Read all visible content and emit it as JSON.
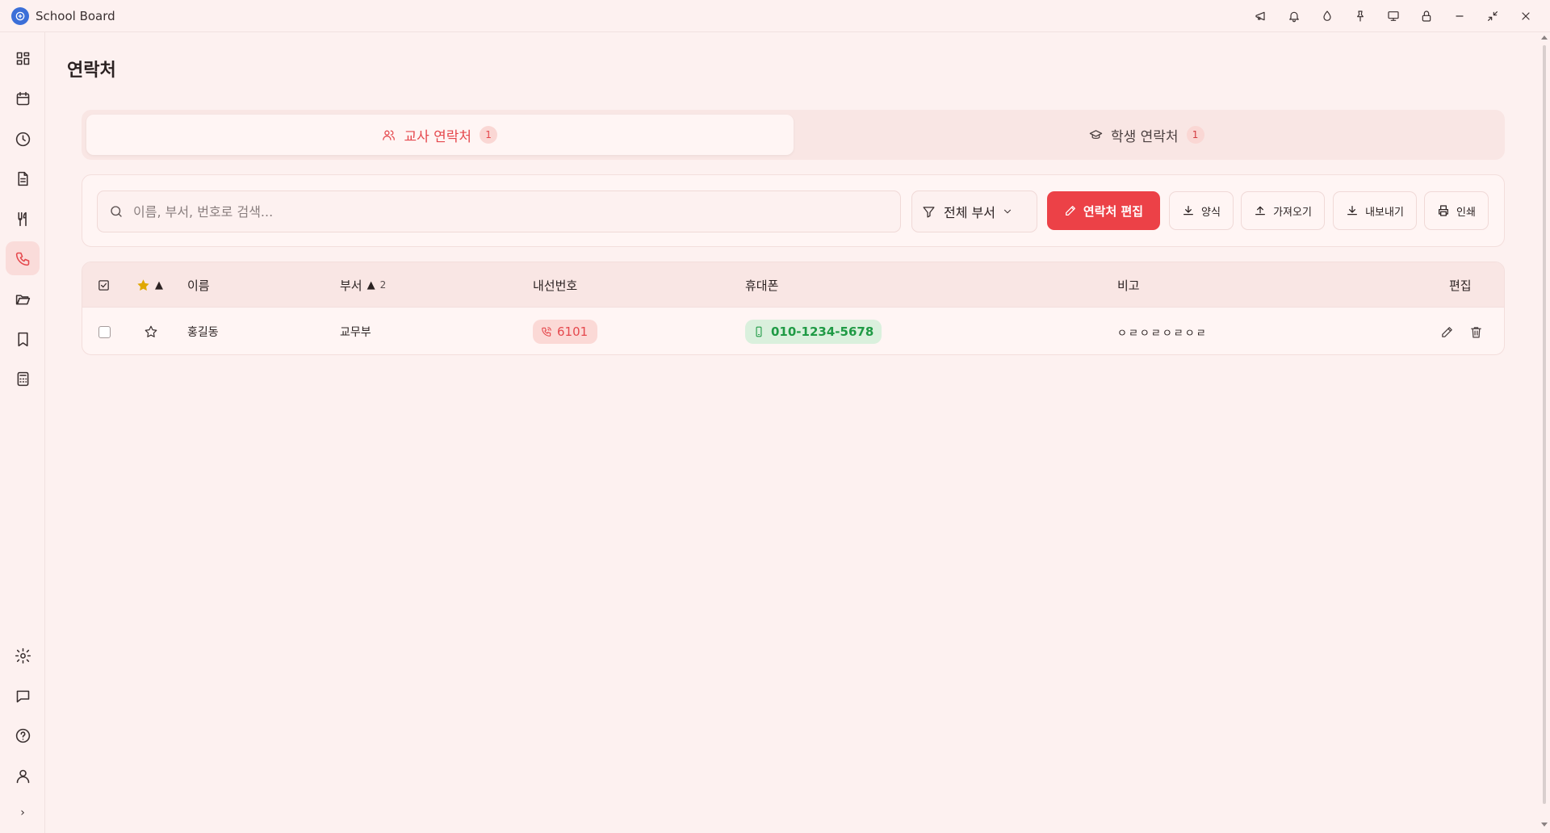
{
  "app": {
    "title": "School Board"
  },
  "page": {
    "title": "연락처"
  },
  "tabs": [
    {
      "label": "교사 연락처",
      "count": "1",
      "icon": "users-icon",
      "active": true
    },
    {
      "label": "학생 연락처",
      "count": "1",
      "icon": "graduation-cap-icon",
      "active": false
    }
  ],
  "toolbar": {
    "search_placeholder": "이름, 부서, 번호로 검색...",
    "search_value": "",
    "department_filter": "전체 부서",
    "edit_label": "연락처 편집",
    "template_label": "양식",
    "import_label": "가져오기",
    "export_label": "내보내기",
    "print_label": "인쇄"
  },
  "table": {
    "headers": {
      "favorite_sort": "▲",
      "name": "이름",
      "department": "부서",
      "department_sort": "▲",
      "department_sort_count": "2",
      "extension": "내선번호",
      "mobile": "휴대폰",
      "note": "비고",
      "edit": "편집"
    },
    "rows": [
      {
        "name": "홍길동",
        "department": "교무부",
        "extension": "6101",
        "mobile": "010-1234-5678",
        "note": "ㅇㄹㅇㄹㅇㄹㅇㄹ",
        "favorite": false
      }
    ]
  },
  "colors": {
    "accent": "#e5484d",
    "primary_button": "#ec4147",
    "mobile_green": "#1f9a45",
    "favorite_gold": "#e0a800",
    "background": "#fdf1f0"
  }
}
